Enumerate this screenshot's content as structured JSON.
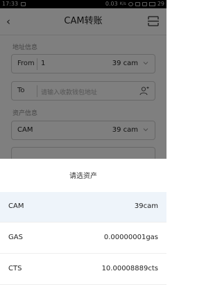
{
  "status_bar": {
    "time": "17:33",
    "speed": "0.03",
    "speed_unit": "K/s",
    "battery": "29"
  },
  "header": {
    "back_icon": "chevron-left",
    "title": "CAM转账",
    "scan_icon": "scan"
  },
  "address_section": {
    "title": "地址信息",
    "from_label": "From",
    "from_value": "1",
    "from_balance": "39 cam",
    "to_label": "To",
    "to_placeholder": "请输入收款钱包地址",
    "contact_icon": "contact"
  },
  "asset_section": {
    "title": "资产信息",
    "asset_value": "CAM",
    "asset_balance": "39 cam"
  },
  "sheet": {
    "title": "请选资产",
    "assets": [
      {
        "name": "CAM",
        "amount": "39cam",
        "selected": true
      },
      {
        "name": "GAS",
        "amount": "0.00000001gas",
        "selected": false
      },
      {
        "name": "CTS",
        "amount": "10.00008889cts",
        "selected": false
      }
    ]
  },
  "colors": {
    "selected_row": "#eef4fa",
    "overlay": "#000000"
  }
}
